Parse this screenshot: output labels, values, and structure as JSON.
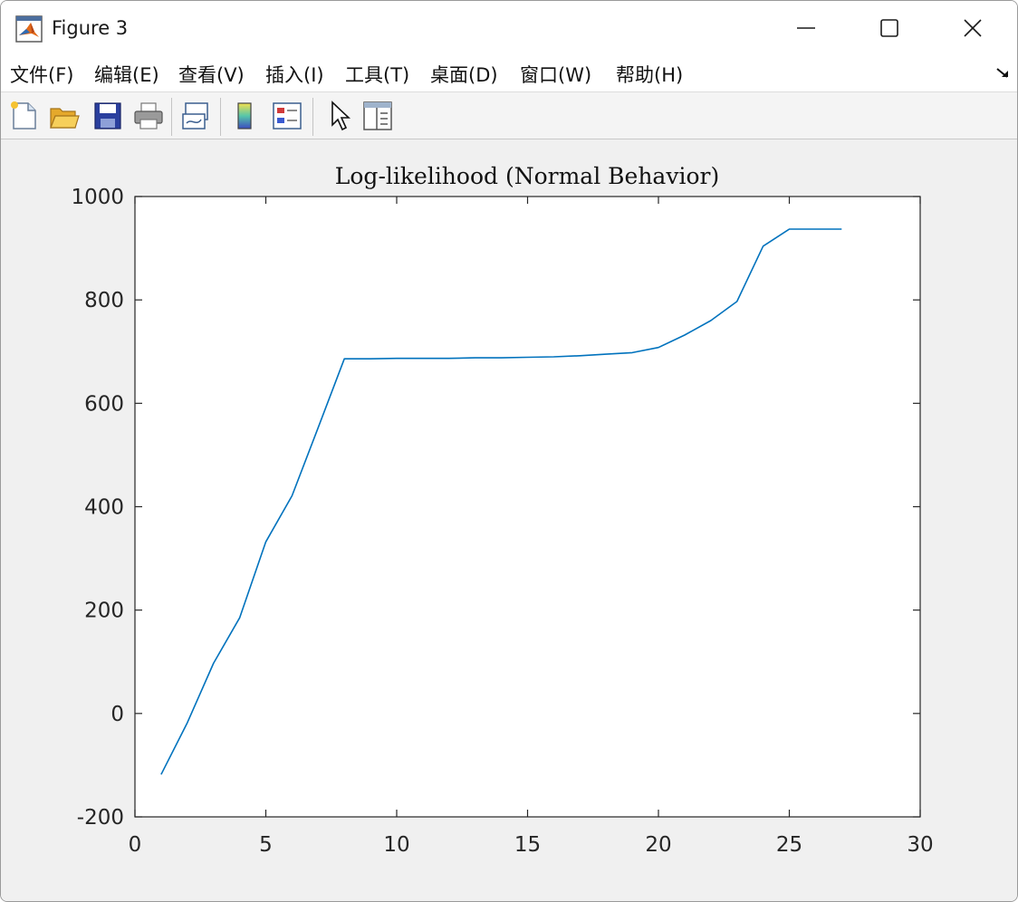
{
  "window": {
    "title": "Figure 3"
  },
  "menubar": {
    "items": [
      {
        "label": "文件(F)"
      },
      {
        "label": "编辑(E)"
      },
      {
        "label": "查看(V)"
      },
      {
        "label": "插入(I)"
      },
      {
        "label": "工具(T)"
      },
      {
        "label": "桌面(D)"
      },
      {
        "label": "窗口(W)"
      },
      {
        "label": "帮助(H)"
      }
    ]
  },
  "toolbar": {
    "buttons": [
      "new-figure-icon",
      "open-file-icon",
      "save-icon",
      "print-icon",
      "link-plot-icon",
      "colorbar-icon",
      "legend-icon",
      "edit-plot-arrow-icon",
      "property-inspector-icon"
    ]
  },
  "colors": {
    "line": "#0072bd",
    "axes": "#262626",
    "window_bg": "#f0f0f0"
  },
  "chart_data": {
    "type": "line",
    "title": "Log-likelihood (Normal Behavior)",
    "xlabel": "",
    "ylabel": "",
    "xlim": [
      0,
      30
    ],
    "ylim": [
      -200,
      1000
    ],
    "xticks": [
      0,
      5,
      10,
      15,
      20,
      25,
      30
    ],
    "yticks": [
      -200,
      0,
      200,
      400,
      600,
      800,
      1000
    ],
    "grid": false,
    "x": [
      1,
      2,
      3,
      4,
      5,
      6,
      7,
      8,
      9,
      10,
      11,
      12,
      13,
      14,
      15,
      16,
      17,
      18,
      19,
      20,
      21,
      22,
      23,
      24,
      25,
      26,
      27
    ],
    "y": [
      -118,
      -18,
      97,
      185,
      332,
      421,
      553,
      686,
      686,
      687,
      687,
      687,
      688,
      688,
      689,
      690,
      692,
      695,
      698,
      708,
      732,
      760,
      797,
      904,
      937,
      937,
      937
    ]
  }
}
